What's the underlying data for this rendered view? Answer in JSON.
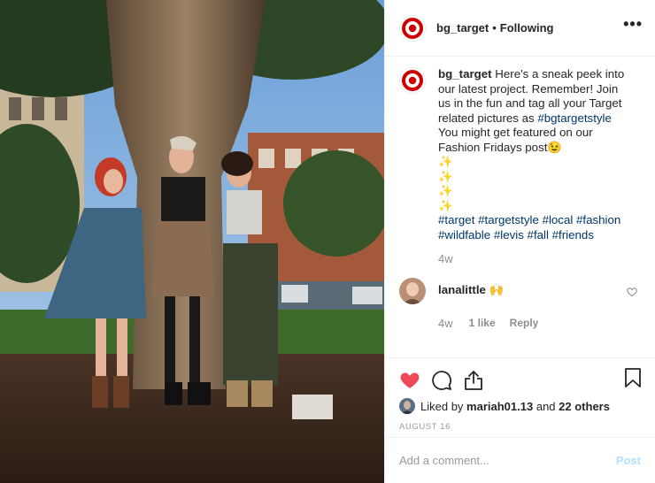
{
  "header": {
    "username": "bg_target",
    "separator": "•",
    "follow_status": "Following",
    "more_label": "•••"
  },
  "caption": {
    "username": "bg_target",
    "text_1": "Here's a sneak peek into our latest project. Remember! Join us in the fun and tag all your Target related pictures as",
    "tag_1": "#bgtargetstyle",
    "text_2": "You might get featured on our Fashion Fridays post",
    "emoji_wink": "😉",
    "sparkles": [
      "✨",
      "✨",
      "✨",
      "✨"
    ],
    "tags": [
      "#target",
      "#targetstyle",
      "#local",
      "#fashion",
      "#wildfable",
      "#levis",
      "#fall",
      "#friends"
    ],
    "time": "4w"
  },
  "reply": {
    "username": "lanalittle",
    "text": "🙌",
    "time": "4w",
    "likes": "1 like",
    "reply_label": "Reply"
  },
  "likes": {
    "prefix": "Liked by",
    "user": "mariah01.13",
    "middle": "and",
    "others": "22 others"
  },
  "date": "AUGUST 16",
  "comment_box": {
    "placeholder": "Add a comment...",
    "post_label": "Post"
  },
  "colors": {
    "target_red": "#cc0000",
    "like_red": "#ed4956",
    "link_blue": "#003569",
    "post_disabled": "#b2dffc"
  },
  "icons": {
    "heart": "heart-icon",
    "comment": "comment-icon",
    "share": "share-icon",
    "bookmark": "bookmark-icon"
  }
}
